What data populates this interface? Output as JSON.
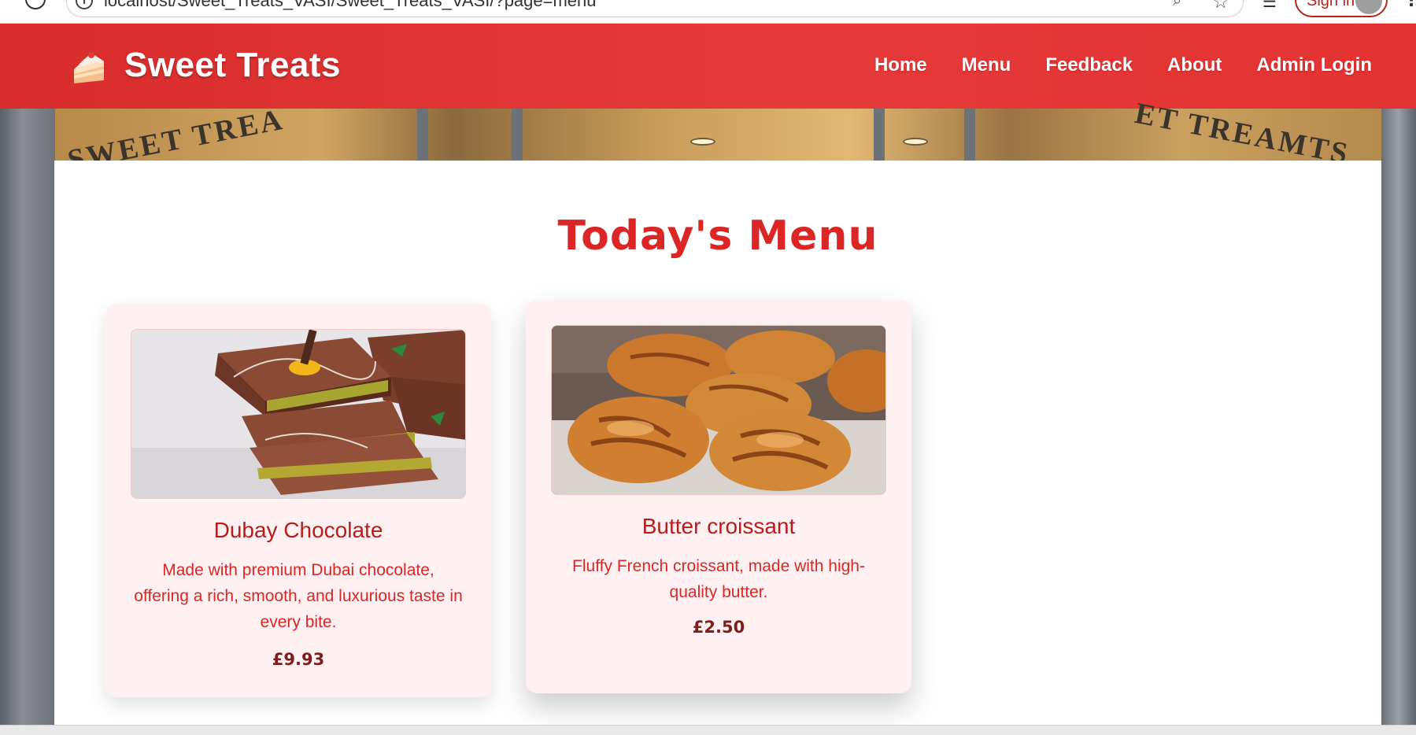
{
  "browser": {
    "url": "localhost/Sweet_Treats_VASI/Sweet_Treats_VASI/?page=menu",
    "signin_label": "Sign in"
  },
  "header": {
    "brand": "Sweet Treats",
    "nav": [
      "Home",
      "Menu",
      "Feedback",
      "About",
      "Admin Login"
    ]
  },
  "storefront": {
    "sign_left": "SWEET TREA",
    "sign_right": "ET TREAMTS"
  },
  "main": {
    "title": "Today's Menu",
    "items": [
      {
        "name": "Dubay Chocolate",
        "description": "Made with premium Dubai chocolate, offering a rich, smooth, and luxurious taste in every bite.",
        "price": "£9.93",
        "image": "chocolate-bar-image"
      },
      {
        "name": "Butter croissant",
        "description": "Fluffy French croissant, made with high-quality butter.",
        "price": "£2.50",
        "image": "croissant-image"
      }
    ]
  },
  "colors": {
    "header_red": "#e03434",
    "title_red": "#dc2626",
    "card_bg": "#fff1f1",
    "price_dark": "#7f1d1d"
  }
}
